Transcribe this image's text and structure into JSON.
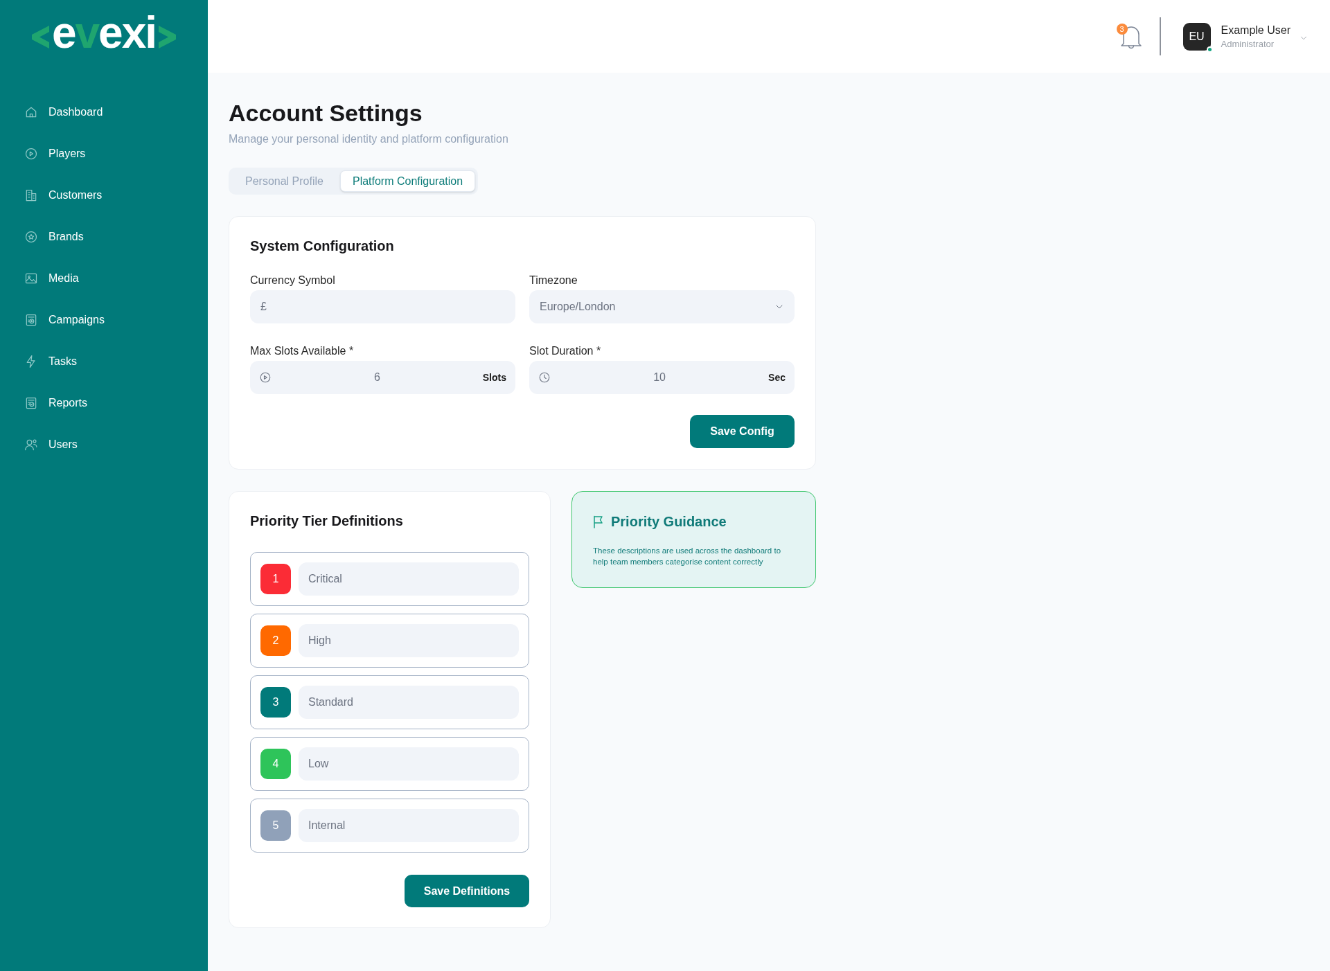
{
  "sidebar": {
    "logo": {
      "parts": [
        {
          "text": "e",
          "accent": false
        },
        {
          "text": "v",
          "accent": true
        },
        {
          "text": "exi",
          "accent": false
        }
      ]
    },
    "nav": [
      {
        "label": "Dashboard",
        "selected": false
      },
      {
        "label": "Players",
        "selected": false
      },
      {
        "label": "Customers",
        "selected": false
      },
      {
        "label": "Brands",
        "selected": false
      },
      {
        "label": "Media",
        "selected": false
      },
      {
        "label": "Campaigns",
        "selected": false
      },
      {
        "label": "Tasks",
        "selected": false
      },
      {
        "label": "Reports",
        "selected": false
      },
      {
        "label": "Users",
        "selected": false
      }
    ]
  },
  "header": {
    "notifications": {
      "count": "3"
    },
    "user": {
      "initials": "EU",
      "name": "Example User",
      "role": "Administrator",
      "online": true
    }
  },
  "page": {
    "title": "Account Settings",
    "subtitle": "Manage your personal identity and platform configuration",
    "tabs": [
      {
        "label": "Personal Profile",
        "selected": false
      },
      {
        "label": "Platform Configuration",
        "selected": true
      }
    ]
  },
  "system_configuration": {
    "title": "System Configuration",
    "fields": [
      {
        "kind": "text",
        "label": "Currency Symbol",
        "value": "£"
      },
      {
        "kind": "select",
        "label": "Timezone",
        "value": "Europe/London"
      },
      {
        "kind": "count",
        "label": "Max Slots Available *",
        "value": "6",
        "unit": "Slots"
      },
      {
        "kind": "duration",
        "label": "Slot Duration *",
        "value": "10",
        "unit": "Sec"
      }
    ],
    "button": "Save Config"
  },
  "priority_tiers": {
    "title": "Priority Tier Definitions",
    "tiers": [
      {
        "number": "1",
        "name": "Critical",
        "color": "#fb2c36"
      },
      {
        "number": "2",
        "name": "High",
        "color": "#ff6900"
      },
      {
        "number": "3",
        "name": "Standard",
        "color": "#017a7a"
      },
      {
        "number": "4",
        "name": "Low",
        "color": "#2ec45a"
      },
      {
        "number": "5",
        "name": "Internal",
        "color": "#90a1b9"
      }
    ],
    "button": "Save Definitions"
  },
  "priority_guidance": {
    "title": "Priority Guidance",
    "text": "These descriptions are used across the dashboard to help team members categorise content correctly"
  }
}
